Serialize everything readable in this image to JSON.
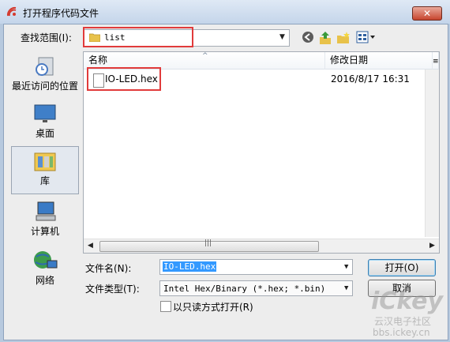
{
  "window": {
    "title": "打开程序代码文件",
    "close_label": "✕"
  },
  "lookin": {
    "label": "查找范围(I):",
    "value": "list"
  },
  "toolbar": {
    "back_icon": "back-arrow-icon",
    "up_icon": "up-folder-icon",
    "new_folder_icon": "new-folder-icon",
    "view_icon": "view-menu-icon"
  },
  "places": [
    {
      "label": "最近访问的位置",
      "icon": "recent-places-icon"
    },
    {
      "label": "桌面",
      "icon": "desktop-icon"
    },
    {
      "label": "库",
      "icon": "libraries-icon",
      "selected": true
    },
    {
      "label": "计算机",
      "icon": "computer-icon"
    },
    {
      "label": "网络",
      "icon": "network-icon"
    }
  ],
  "list": {
    "columns": [
      "名称",
      "修改日期",
      "≡"
    ],
    "rows": [
      {
        "name": "IO-LED.hex",
        "modified": "2016/8/17 16:31"
      }
    ]
  },
  "filename": {
    "label": "文件名(N):",
    "value": "IO-LED.hex"
  },
  "filetype": {
    "label": "文件类型(T):",
    "value": "Intel Hex/Binary (*.hex; *.bin)"
  },
  "buttons": {
    "open": "打开(O)",
    "cancel": "取消"
  },
  "readonly": {
    "label": "以只读方式打开(R)"
  },
  "watermark": {
    "brand": "iCkey",
    "line1": "云汉电子社区",
    "line2": "bbs.ickey.cn"
  },
  "colors": {
    "highlight": "#e13b3b",
    "selection": "#3399ff"
  }
}
